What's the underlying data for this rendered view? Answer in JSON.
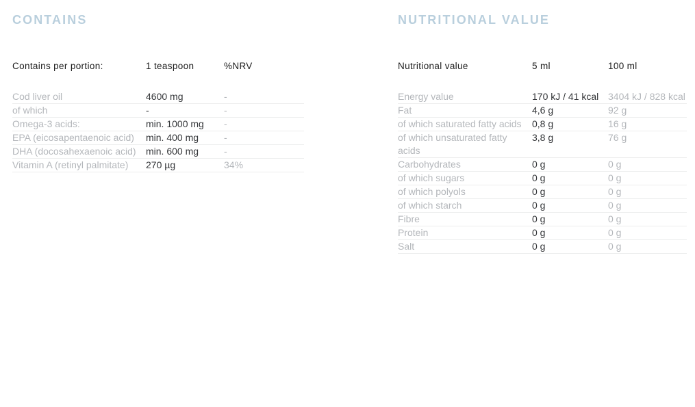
{
  "left_panel": {
    "heading": "CONTAINS",
    "columns": [
      "Contains per portion:",
      "1 teaspoon",
      "%NRV"
    ],
    "rows": [
      {
        "name": "Cod liver oil",
        "portion": "4600 mg",
        "nrv": "-"
      },
      {
        "name": "of which",
        "portion": "-",
        "nrv": "-"
      },
      {
        "name": "Omega-3 acids:",
        "portion": "min. 1000 mg",
        "nrv": "-"
      },
      {
        "name": "EPA (eicosapentaenoic acid)",
        "portion": "min. 400 mg",
        "nrv": "-"
      },
      {
        "name": "DHA (docosahexaenoic acid)",
        "portion": "min. 600 mg",
        "nrv": "-"
      },
      {
        "name": "Vitamin A (retinyl palmitate)",
        "portion": "270 µg",
        "nrv": "34%"
      }
    ]
  },
  "right_panel": {
    "heading": "NUTRITIONAL VALUE",
    "columns": [
      "Nutritional value",
      "5 ml",
      "100 ml"
    ],
    "rows": [
      {
        "name": "Energy value",
        "per5ml": "170 kJ / 41 kcal",
        "per100ml": "3404 kJ / 828 kcal"
      },
      {
        "name": "Fat",
        "per5ml": "4,6 g",
        "per100ml": "92 g"
      },
      {
        "name": "of which saturated fatty acids",
        "per5ml": "0,8 g",
        "per100ml": "16 g"
      },
      {
        "name": "of which unsaturated fatty acids",
        "per5ml": "3,8 g",
        "per100ml": "76 g"
      },
      {
        "name": "Carbohydrates",
        "per5ml": "0 g",
        "per100ml": "0 g"
      },
      {
        "name": "of which sugars",
        "per5ml": "0 g",
        "per100ml": "0 g"
      },
      {
        "name": "of which polyols",
        "per5ml": "0 g",
        "per100ml": "0 g"
      },
      {
        "name": "of which starch",
        "per5ml": "0 g",
        "per100ml": "0 g"
      },
      {
        "name": "Fibre",
        "per5ml": "0 g",
        "per100ml": "0 g"
      },
      {
        "name": "Protein",
        "per5ml": "0 g",
        "per100ml": "0 g"
      },
      {
        "name": "Salt",
        "per5ml": "0 g",
        "per100ml": "0 g"
      }
    ]
  },
  "colors": {
    "heading": "#b9cfdd",
    "label_text": "#b4b7bb",
    "primary_value_text": "#333538",
    "header_text": "#1b1b1b",
    "row_divider": "#eceded",
    "background": "#ffffff"
  }
}
